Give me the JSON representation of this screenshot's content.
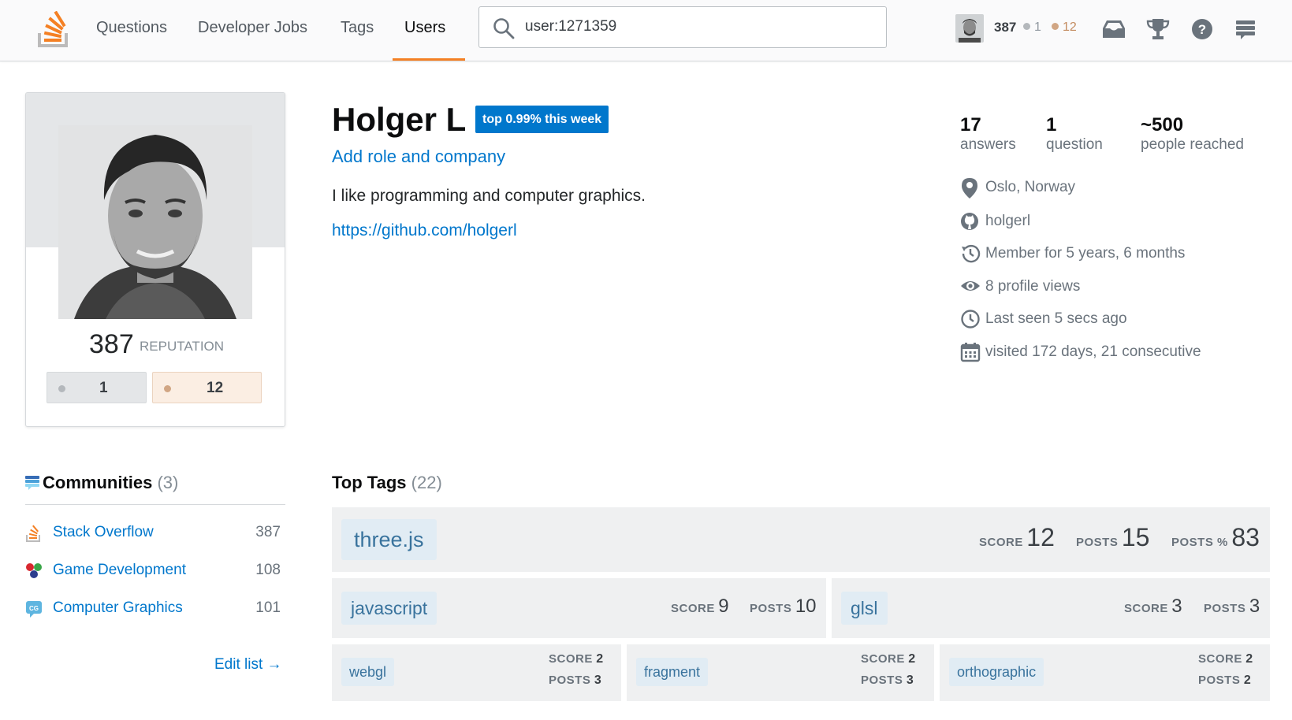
{
  "nav": {
    "items": [
      {
        "label": "Questions"
      },
      {
        "label": "Developer Jobs"
      },
      {
        "label": "Tags"
      },
      {
        "label": "Users"
      }
    ],
    "active": "Users",
    "accent_color": "#f48024"
  },
  "search": {
    "value": "user:1271359",
    "icon": "search-icon"
  },
  "topbar_user": {
    "reputation": "387",
    "silver": "1",
    "bronze": "12"
  },
  "profile": {
    "reputation": "387",
    "reputation_label": "REPUTATION",
    "silver_badges": "1",
    "bronze_badges": "12",
    "name": "Holger L",
    "top_badge": "top 0.99% this week",
    "role_link": "Add role and company",
    "bio": "I like programming and computer graphics.",
    "website": "https://github.com/holgerl"
  },
  "stats": {
    "answers": {
      "value": "17",
      "label": "answers"
    },
    "questions": {
      "value": "1",
      "label": "question"
    },
    "reached": {
      "value": "~500",
      "label": "people reached"
    }
  },
  "meta": {
    "location": "Oslo, Norway",
    "github": "holgerl",
    "member": "Member for 5 years, 6 months",
    "views": "8 profile views",
    "last_seen": "Last seen 5 secs ago",
    "visited": "visited 172 days, 21 consecutive"
  },
  "communities": {
    "title": "Communities",
    "count": "(3)",
    "items": [
      {
        "label": "Stack Overflow",
        "rep": "387"
      },
      {
        "label": "Game Development",
        "rep": "108"
      },
      {
        "label": "Computer Graphics",
        "rep": "101"
      }
    ],
    "edit_link": "Edit list →"
  },
  "top_tags": {
    "title": "Top Tags",
    "count": "(22)",
    "score_label": "SCORE",
    "posts_label": "POSTS",
    "posts_pct_label": "POSTS %",
    "tags": [
      {
        "name": "three.js",
        "score": "12",
        "posts": "15",
        "posts_pct": "83"
      },
      {
        "name": "javascript",
        "score": "9",
        "posts": "10"
      },
      {
        "name": "glsl",
        "score": "3",
        "posts": "3"
      },
      {
        "name": "webgl",
        "score": "2",
        "posts": "3"
      },
      {
        "name": "fragment",
        "score": "2",
        "posts": "3"
      },
      {
        "name": "orthographic",
        "score": "2",
        "posts": "2"
      }
    ]
  },
  "colors": {
    "link": "#0077cc",
    "silver": "#b4b8bc",
    "bronze": "#d1a684",
    "tag_bg": "#e1ecf4"
  }
}
